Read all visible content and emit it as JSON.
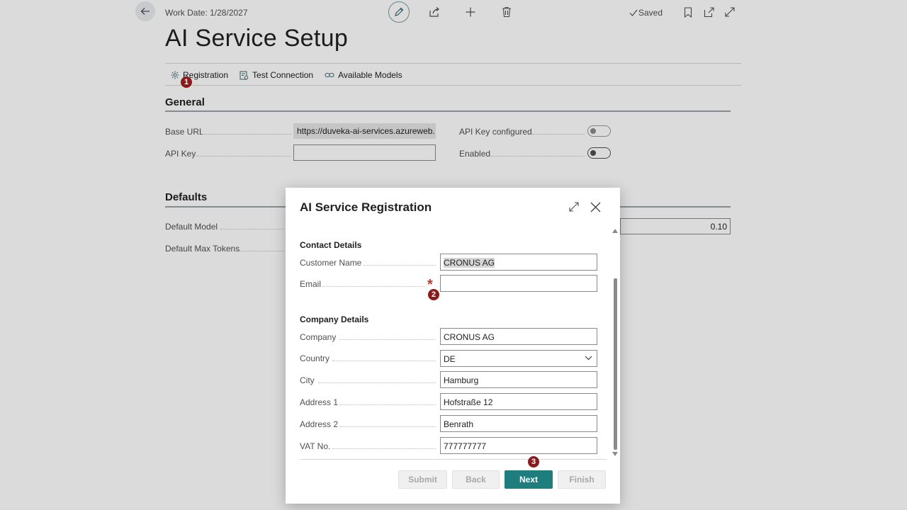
{
  "topbar": {
    "work_date": "Work Date: 1/28/2027",
    "saved": "Saved"
  },
  "page": {
    "title": "AI Service Setup",
    "actions": [
      {
        "label": "Registration",
        "icon": "gear-icon"
      },
      {
        "label": "Test Connection",
        "icon": "test-connection-icon"
      },
      {
        "label": "Available Models",
        "icon": "link-icon"
      }
    ]
  },
  "general": {
    "title": "General",
    "base_url_label": "Base URL",
    "base_url_value": "https://duveka-ai-services.azureweb...",
    "api_key_label": "API Key",
    "api_key_value": "",
    "api_key_configured_label": "API Key configured",
    "api_key_configured": false,
    "enabled_label": "Enabled",
    "enabled": false
  },
  "defaults": {
    "title": "Defaults",
    "default_model_label": "Default Model",
    "default_max_tokens_label": "Default Max Tokens",
    "temperature_value": "0.10"
  },
  "dialog": {
    "title": "AI Service Registration",
    "contact_heading": "Contact Details",
    "customer_name_label": "Customer Name",
    "customer_name_value": "CRONUS AG",
    "email_label": "Email",
    "email_value": "",
    "email_required_mark": "*",
    "company_heading": "Company Details",
    "company_label": "Company",
    "company_value": "CRONUS AG",
    "country_label": "Country",
    "country_value": "DE",
    "city_label": "City",
    "city_value": "Hamburg",
    "address1_label": "Address 1",
    "address1_value": "Hofstraße 12",
    "address2_label": "Address 2",
    "address2_value": "Benrath",
    "vat_label": "VAT No.",
    "vat_value": "777777777",
    "buttons": {
      "submit": "Submit",
      "back": "Back",
      "next": "Next",
      "finish": "Finish"
    }
  },
  "annotations": {
    "step1": "1",
    "step2": "2",
    "step3": "3"
  },
  "colors": {
    "primary": "#1e7e7e",
    "badge": "#8b1a1a",
    "required": "#c0392b"
  }
}
